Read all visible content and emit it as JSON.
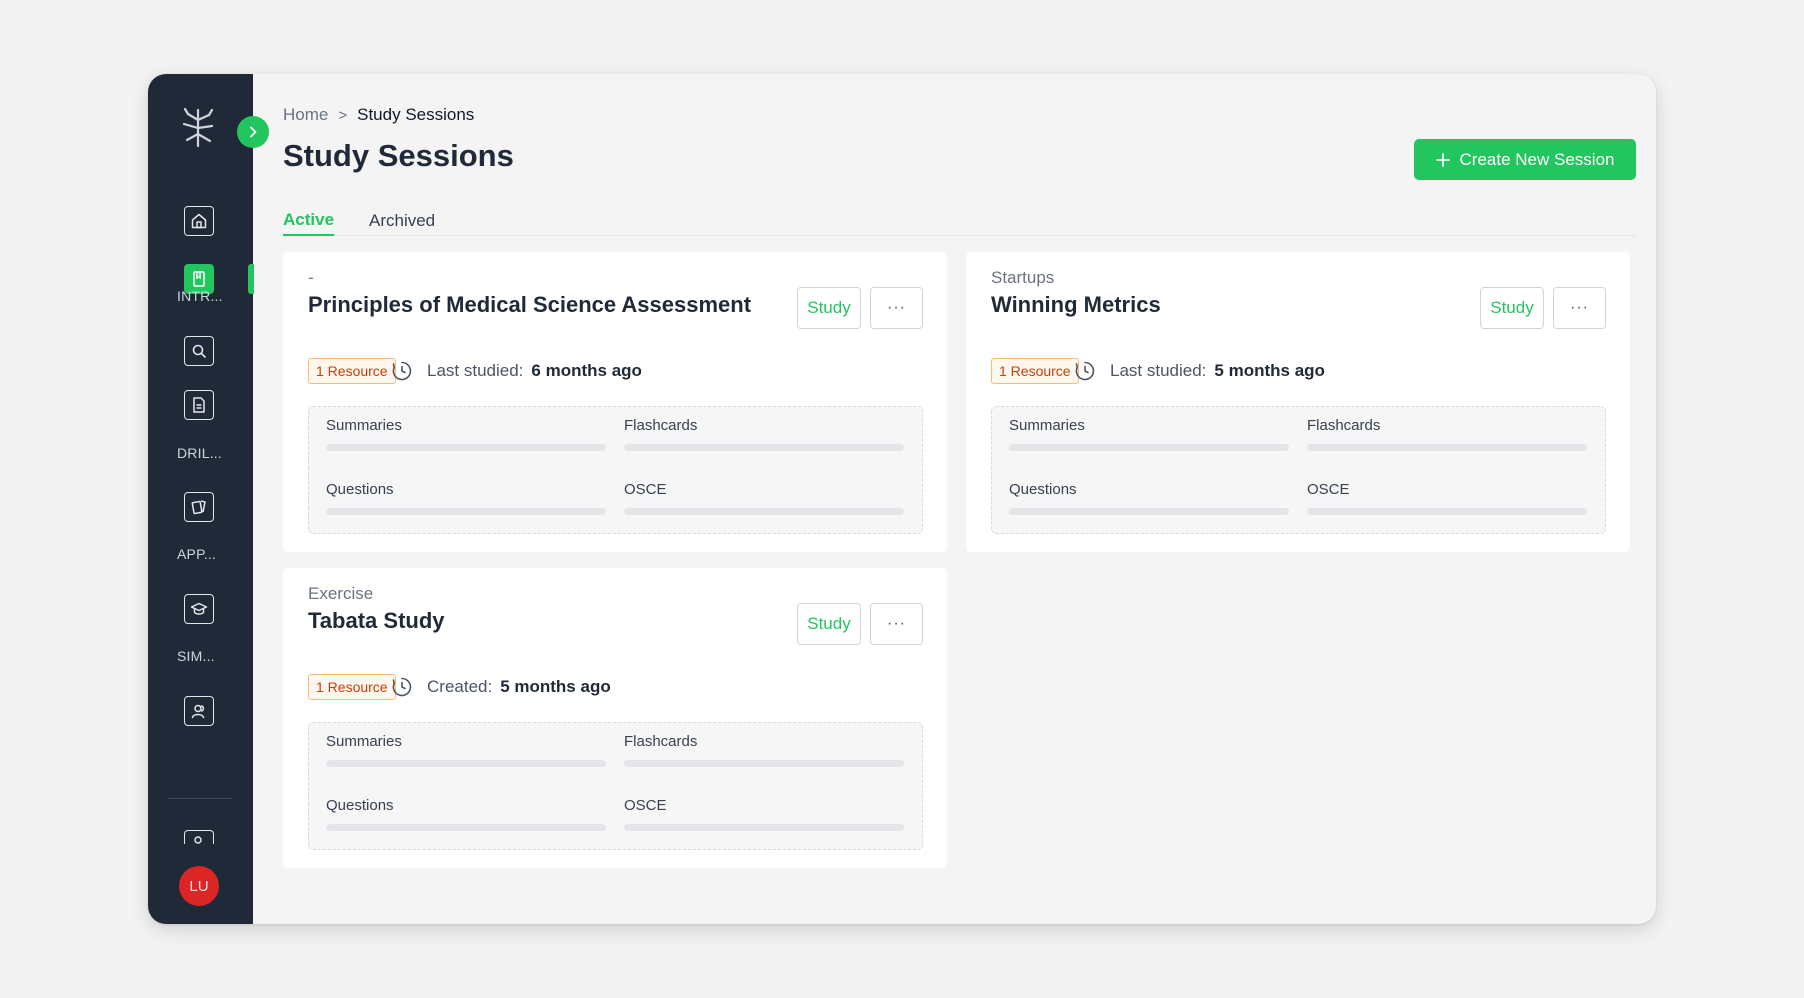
{
  "sidebar": {
    "sections": [
      "INTR...",
      "DRIL...",
      "APP...",
      "SIM..."
    ],
    "avatar_initials": "LU"
  },
  "breadcrumb": {
    "home": "Home",
    "separator": ">",
    "current": "Study Sessions"
  },
  "page": {
    "title": "Study Sessions",
    "create_button": "Create New Session"
  },
  "tabs": [
    {
      "label": "Active",
      "active": true
    },
    {
      "label": "Archived",
      "active": false
    }
  ],
  "cards": [
    {
      "category": "-",
      "title": "Principles of Medical Science Assessment",
      "study_label": "Study",
      "more_label": "···",
      "badge": "1 Resource",
      "meta_label": "Last studied:",
      "meta_value": "6 months ago",
      "stats": [
        {
          "label": "Summaries",
          "progress": 0
        },
        {
          "label": "Flashcards",
          "progress": 0
        },
        {
          "label": "Questions",
          "progress": 0
        },
        {
          "label": "OSCE",
          "progress": 0
        }
      ]
    },
    {
      "category": "Startups",
      "title": "Winning Metrics",
      "study_label": "Study",
      "more_label": "···",
      "badge": "1 Resource",
      "meta_label": "Last studied:",
      "meta_value": "5 months ago",
      "stats": [
        {
          "label": "Summaries",
          "progress": 0
        },
        {
          "label": "Flashcards",
          "progress": 0
        },
        {
          "label": "Questions",
          "progress": 0
        },
        {
          "label": "OSCE",
          "progress": 0
        }
      ]
    },
    {
      "category": "Exercise",
      "title": "Tabata Study",
      "study_label": "Study",
      "more_label": "···",
      "badge": "1 Resource",
      "meta_label": "Created:",
      "meta_value": "5 months ago",
      "stats": [
        {
          "label": "Summaries",
          "progress": 0
        },
        {
          "label": "Flashcards",
          "progress": 0
        },
        {
          "label": "Questions",
          "progress": 0
        },
        {
          "label": "OSCE",
          "progress": 0
        }
      ]
    }
  ],
  "colors": {
    "accent": "#22c55e",
    "sidebar": "#1f2937",
    "badge_text": "#c2410c",
    "avatar": "#dc2626"
  }
}
